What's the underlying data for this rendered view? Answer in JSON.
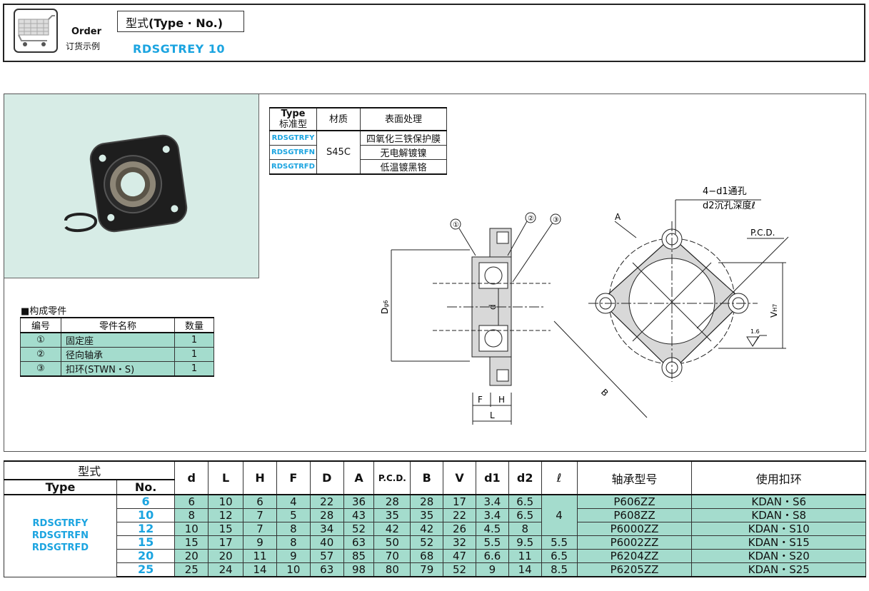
{
  "order": {
    "label_en": "Order",
    "label_cn": "订货示例",
    "type_prefix": "型式",
    "type_label": "(Type · No.)",
    "example": "RDSGTREY  10"
  },
  "material_table": {
    "headers": {
      "type": "Type",
      "type_cn": "标准型",
      "material": "材质",
      "surface": "表面处理"
    },
    "material": "S45C",
    "rows": [
      {
        "code": "RDSGTRFY",
        "surface": "四氧化三铁保护膜"
      },
      {
        "code": "RDSGTRFN",
        "surface": "无电解镀镍"
      },
      {
        "code": "RDSGTRFD",
        "surface": "低温镀黑铬"
      }
    ]
  },
  "parts": {
    "title": "■构成零件",
    "headers": [
      "编号",
      "零件名称",
      "数量"
    ],
    "rows": [
      {
        "num": "①",
        "name": "固定座",
        "qty": "1"
      },
      {
        "num": "②",
        "name": "径向轴承",
        "qty": "1"
      },
      {
        "num": "③",
        "name": "扣环(STWN・S)",
        "qty": "1"
      }
    ]
  },
  "drawing": {
    "callout_1": "①",
    "callout_2": "②",
    "callout_3": "③",
    "dim_d_g6": "D",
    "dim_g6_sub": "g6",
    "dim_d": "d",
    "dim_f": "F",
    "dim_h": "H",
    "dim_l": "L",
    "dim_a": "A",
    "dim_b": "B",
    "dim_pcd": "P.C.D.",
    "dim_v": "V",
    "dim_h7": "H7",
    "roughness": "1.6",
    "hole_note_1": "4−d1通孔",
    "hole_note_2": "d2沉孔深度ℓ"
  },
  "spec_table": {
    "header_model": "型式",
    "header_type": "Type",
    "header_no": "No.",
    "columns": [
      "d",
      "L",
      "H",
      "F",
      "D",
      "A",
      "P.C.D.",
      "B",
      "V",
      "d1",
      "d2",
      "ℓ",
      "轴承型号",
      "使用扣环"
    ],
    "types": [
      "RDSGTRFY",
      "RDSGTRFN",
      "RDSGTRFD"
    ],
    "rows": [
      {
        "no": "6",
        "vals": [
          "6",
          "10",
          "6",
          "4",
          "22",
          "36",
          "28",
          "28",
          "17",
          "3.4",
          "6.5"
        ],
        "l": "4",
        "bearing": "P606ZZ",
        "ring": "KDAN・S6"
      },
      {
        "no": "10",
        "vals": [
          "8",
          "12",
          "7",
          "5",
          "28",
          "43",
          "35",
          "35",
          "22",
          "3.4",
          "6.5"
        ],
        "l": "",
        "bearing": "P608ZZ",
        "ring": "KDAN・S8"
      },
      {
        "no": "12",
        "vals": [
          "10",
          "15",
          "7",
          "8",
          "34",
          "52",
          "42",
          "42",
          "26",
          "4.5",
          "8"
        ],
        "l": "",
        "bearing": "P6000ZZ",
        "ring": "KDAN・S10"
      },
      {
        "no": "15",
        "vals": [
          "15",
          "17",
          "9",
          "8",
          "40",
          "63",
          "50",
          "52",
          "32",
          "5.5",
          "9.5"
        ],
        "l": "5.5",
        "bearing": "P6002ZZ",
        "ring": "KDAN・S15"
      },
      {
        "no": "20",
        "vals": [
          "20",
          "20",
          "11",
          "9",
          "57",
          "85",
          "70",
          "68",
          "47",
          "6.6",
          "11"
        ],
        "l": "6.5",
        "bearing": "P6204ZZ",
        "ring": "KDAN・S20"
      },
      {
        "no": "25",
        "vals": [
          "25",
          "24",
          "14",
          "10",
          "63",
          "98",
          "80",
          "79",
          "52",
          "9",
          "14"
        ],
        "l": "8.5",
        "bearing": "P6205ZZ",
        "ring": "KDAN・S25"
      }
    ]
  }
}
